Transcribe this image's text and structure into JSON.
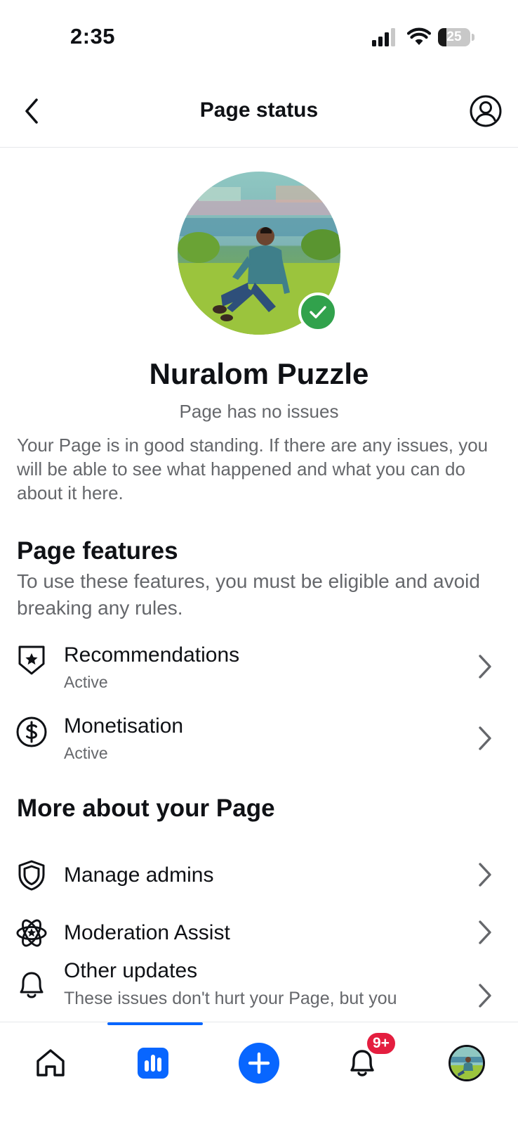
{
  "status_bar": {
    "time": "2:35",
    "battery_level": "25",
    "icons": [
      "signal-icon",
      "wifi-icon",
      "battery-icon"
    ]
  },
  "nav": {
    "title": "Page status",
    "back_icon": "chevron-left-icon",
    "profile_icon": "user-circle-icon"
  },
  "page": {
    "name": "Nuralom Puzzle",
    "substatus": "Page has no issues",
    "description": "Your Page is in good standing. If there are any issues, you will be able to see what happened and what you can do about it here.",
    "verified_icon": "check-badge-icon"
  },
  "features": {
    "title": "Page features",
    "subtitle": "To use these features, you must be eligible and avoid breaking any rules.",
    "items": [
      {
        "label": "Recommendations",
        "status": "Active",
        "icon": "shield-star-icon"
      },
      {
        "label": "Monetisation",
        "status": "Active",
        "icon": "dollar-circle-icon"
      }
    ]
  },
  "more": {
    "title": "More about your Page",
    "items": [
      {
        "label": "Manage admins",
        "icon": "shield-icon"
      },
      {
        "label": "Moderation Assist",
        "icon": "atom-star-icon"
      },
      {
        "label": "Other updates",
        "sub": "These issues don't hurt your Page, but you",
        "icon": "bell-icon"
      }
    ]
  },
  "tab_bar": {
    "tabs": [
      "home-icon",
      "insights-icon",
      "create-icon",
      "notifications-icon",
      "profile-avatar"
    ],
    "notification_badge": "9+",
    "active_tab": "insights-icon"
  },
  "colors": {
    "accent": "#0866ff",
    "success": "#31a24c",
    "badge": "#e41e3f",
    "secondary_text": "#65676b"
  }
}
